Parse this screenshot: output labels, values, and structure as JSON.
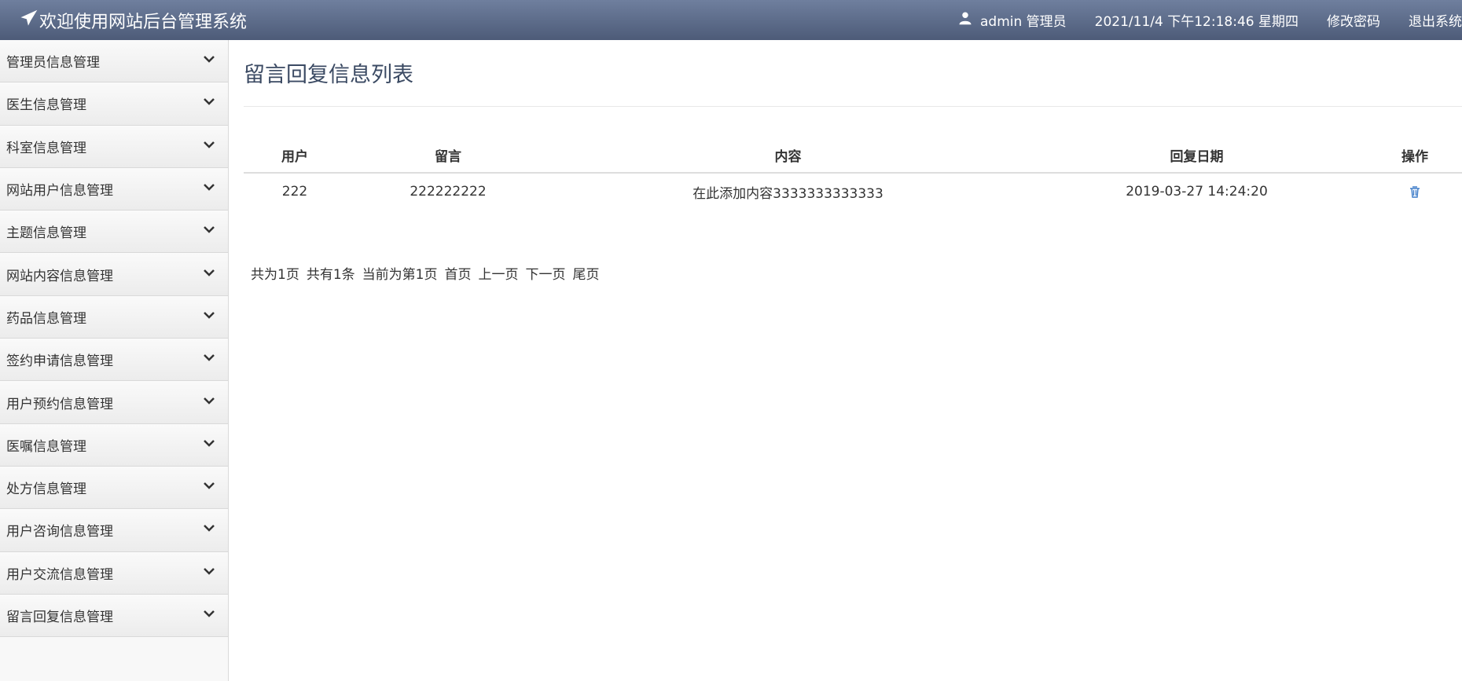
{
  "header": {
    "brand_title": "欢迎使用网站后台管理系统",
    "user_label": "admin 管理员",
    "datetime": "2021/11/4 下午12:18:46 星期四",
    "change_password": "修改密码",
    "logout": "退出系统"
  },
  "sidebar": {
    "items": [
      {
        "label": "管理员信息管理"
      },
      {
        "label": "医生信息管理"
      },
      {
        "label": "科室信息管理"
      },
      {
        "label": "网站用户信息管理"
      },
      {
        "label": "主题信息管理"
      },
      {
        "label": "网站内容信息管理"
      },
      {
        "label": "药品信息管理"
      },
      {
        "label": "签约申请信息管理"
      },
      {
        "label": "用户预约信息管理"
      },
      {
        "label": "医嘱信息管理"
      },
      {
        "label": "处方信息管理"
      },
      {
        "label": "用户咨询信息管理"
      },
      {
        "label": "用户交流信息管理"
      },
      {
        "label": "留言回复信息管理"
      }
    ]
  },
  "main": {
    "title": "留言回复信息列表",
    "table": {
      "headers": {
        "user": "用户",
        "message": "留言",
        "content": "内容",
        "reply_date": "回复日期",
        "actions": "操作"
      },
      "rows": [
        {
          "user": "222",
          "message": "222222222",
          "content": "在此添加内容3333333333333",
          "reply_date": "2019-03-27 14:24:20"
        }
      ]
    },
    "pager": {
      "total_pages": "共为1页",
      "total_records": "共有1条",
      "current_page": "当前为第1页",
      "first": "首页",
      "prev": "上一页",
      "next": "下一页",
      "last": "尾页"
    }
  },
  "colors": {
    "topbar": "#5d6c8a",
    "title": "#3b4a63",
    "icon_blue": "#3d7cc9"
  }
}
